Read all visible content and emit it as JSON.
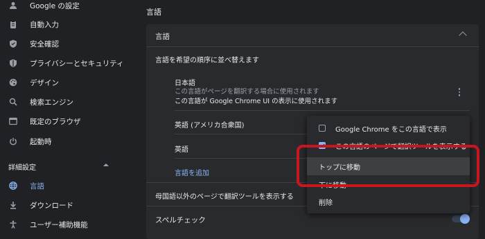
{
  "sidebar": {
    "items": [
      {
        "label": "Google の設定",
        "icon": "person-icon"
      },
      {
        "label": "自動入力",
        "icon": "clipboard-icon"
      },
      {
        "label": "安全確認",
        "icon": "shield-check-icon"
      },
      {
        "label": "プライバシーとセキュリティ",
        "icon": "shield-icon"
      },
      {
        "label": "デザイン",
        "icon": "palette-icon"
      },
      {
        "label": "検索エンジン",
        "icon": "search-icon"
      },
      {
        "label": "既定のブラウザ",
        "icon": "browser-icon"
      },
      {
        "label": "起動時",
        "icon": "power-icon"
      }
    ],
    "advanced_label": "詳細設定",
    "advanced_items": [
      {
        "label": "言語",
        "icon": "globe-icon",
        "active": true
      },
      {
        "label": "ダウンロード",
        "icon": "download-icon"
      },
      {
        "label": "ユーザー補助機能",
        "icon": "accessibility-icon"
      }
    ]
  },
  "main": {
    "page_title": "言語",
    "card_title": "言語",
    "order_heading": "言語を希望の順序に並べ替えます",
    "languages": [
      {
        "name": "日本語",
        "note1": "この言語がページを翻訳する場合に使用されます",
        "note2": "この言語が Google Chrome UI の表示に使用されます"
      },
      {
        "name": "英語 (アメリカ合衆国)"
      },
      {
        "name": "英語"
      }
    ],
    "add_language": "言語を追加",
    "offer_translate": "母国語以外のページで翻訳ツールを表示する",
    "spellcheck": "スペルチェック",
    "spellcheck_on": true
  },
  "menu": {
    "items": [
      {
        "label": "Google Chrome をこの言語で表示",
        "checkbox": true,
        "checked": false
      },
      {
        "label": "この言語のページで翻訳ツールを表示する",
        "checkbox": true,
        "checked": true
      },
      {
        "label": "トップに移動",
        "highlighted": true
      },
      {
        "label": "下に移動"
      },
      {
        "label": "削除"
      }
    ]
  },
  "colors": {
    "background": "#202124",
    "card": "#292a2d",
    "accent": "#8ab4f8",
    "highlight_box": "#c8161e"
  }
}
